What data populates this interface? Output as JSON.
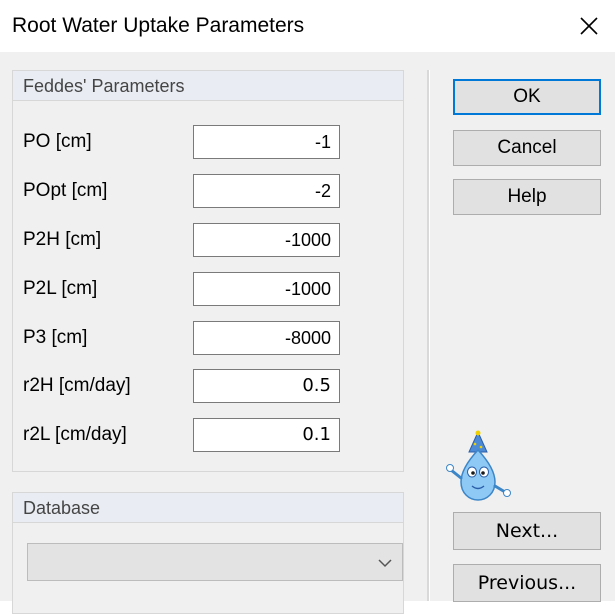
{
  "window": {
    "title": "Root Water Uptake Parameters"
  },
  "feddes": {
    "header": "Feddes' Parameters",
    "params": [
      {
        "label": "PO [cm]",
        "value": "-1"
      },
      {
        "label": "POpt [cm]",
        "value": "-2"
      },
      {
        "label": "P2H [cm]",
        "value": "-1000"
      },
      {
        "label": "P2L [cm]",
        "value": "-1000"
      },
      {
        "label": "P3 [cm]",
        "value": "-8000"
      },
      {
        "label": "r2H [cm/day]",
        "value": "0.5"
      },
      {
        "label": "r2L [cm/day]",
        "value": "0.1"
      }
    ]
  },
  "database": {
    "header": "Database",
    "selected": ""
  },
  "buttons": {
    "ok": "OK",
    "cancel": "Cancel",
    "help": "Help",
    "next": "Next...",
    "previous": "Previous..."
  },
  "colors": {
    "accent": "#0078d7",
    "group_header": "#e9edf3",
    "client_bg": "#f0f0f0",
    "button_bg": "#e1e1e1"
  },
  "icons": {
    "close": "close-icon",
    "dropdown": "chevron-down-icon",
    "mascot": "water-drop-mascot-icon"
  }
}
